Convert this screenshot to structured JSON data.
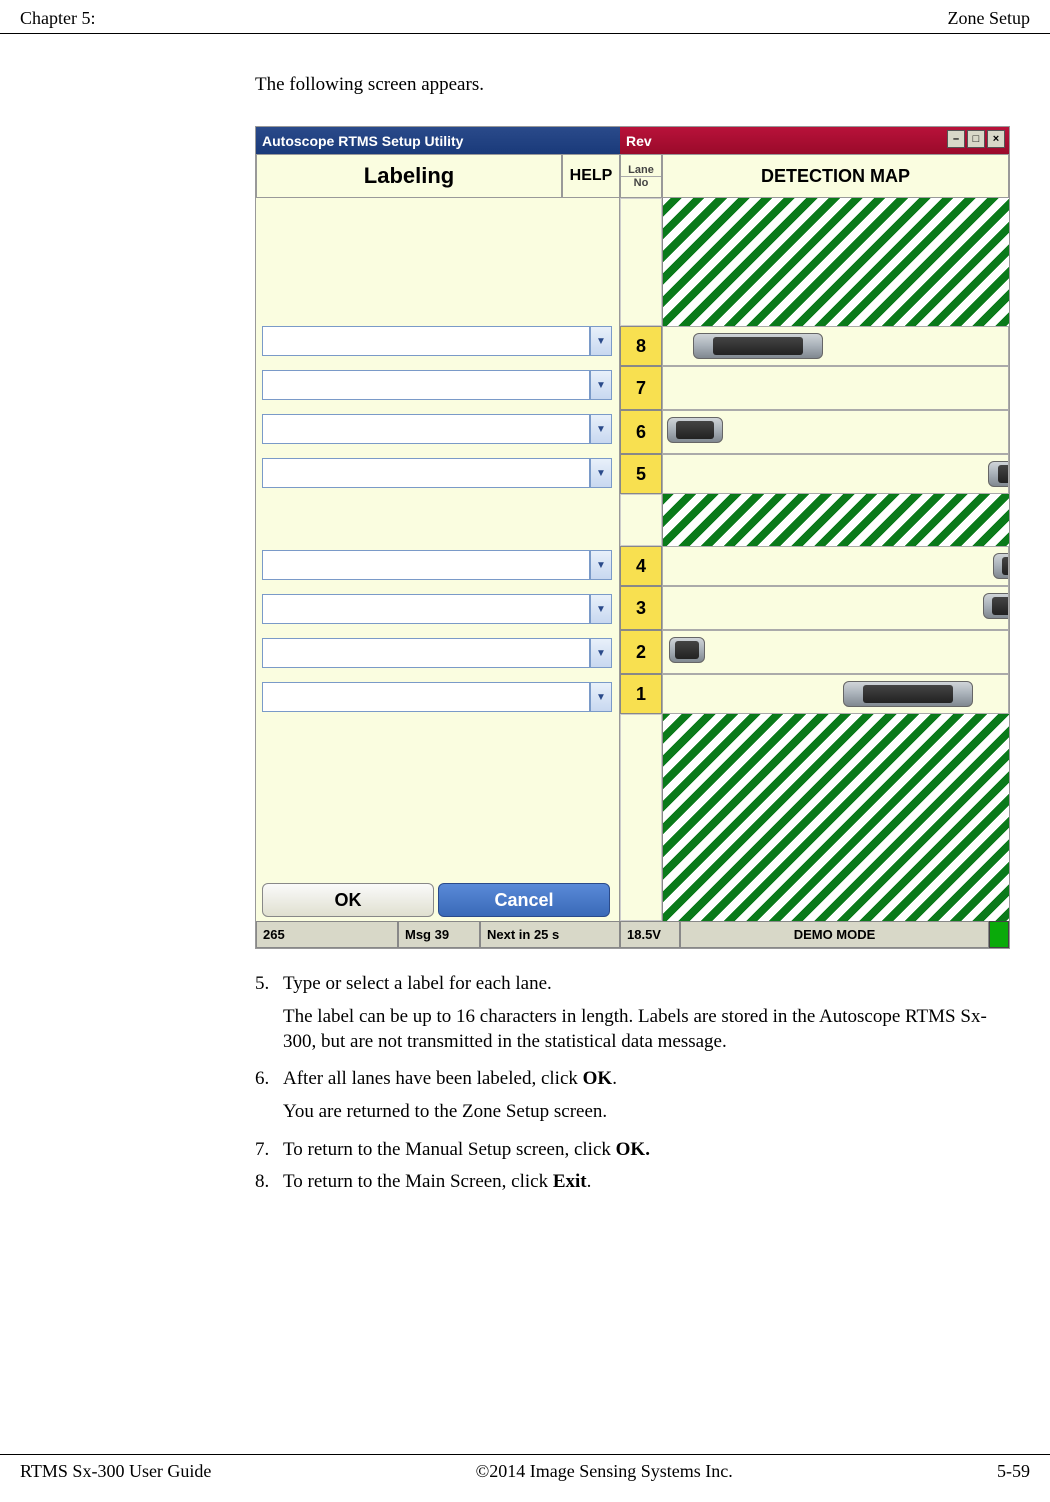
{
  "header": {
    "left": "Chapter 5:",
    "right": "Zone Setup"
  },
  "footer": {
    "left": "RTMS Sx-300 User Guide",
    "center": "©2014 Image Sensing Systems Inc.",
    "right": "5-59"
  },
  "intro": "The following screen appears.",
  "titlebar": {
    "left": "Autoscope RTMS Setup Utility",
    "right": "Rev"
  },
  "hdr": {
    "labeling": "Labeling",
    "help": "HELP",
    "lane": "Lane",
    "no": "No",
    "detmap": "DETECTION MAP"
  },
  "lanes_upper": [
    "8",
    "7",
    "6",
    "5"
  ],
  "lanes_lower": [
    "4",
    "3",
    "2",
    "1"
  ],
  "buttons": {
    "ok": "OK",
    "cancel": "Cancel"
  },
  "status": {
    "s1": "265",
    "s2": "Msg 39",
    "s3": "Next in 25 s",
    "s4": "18.5V",
    "s5": "DEMO MODE"
  },
  "steps": {
    "s5": {
      "n": "5.",
      "t": "Type or select a label for each lane."
    },
    "s5sub": "The label can be up to 16 characters in length. Labels are stored in the Autoscope RTMS Sx-300, but are not transmitted in the statistical data message.",
    "s6a": "After all lanes have been labeled, click ",
    "s6b": "OK",
    "s6c": ".",
    "s6": {
      "n": "6."
    },
    "s6sub": "You are returned to the Zone Setup screen.",
    "s7": {
      "n": "7."
    },
    "s7a": "To return to the Manual Setup screen, click ",
    "s7b": "OK.",
    "s8": {
      "n": "8."
    },
    "s8a": "To return to the Main Screen, click ",
    "s8b": "Exit",
    "s8c": "."
  }
}
